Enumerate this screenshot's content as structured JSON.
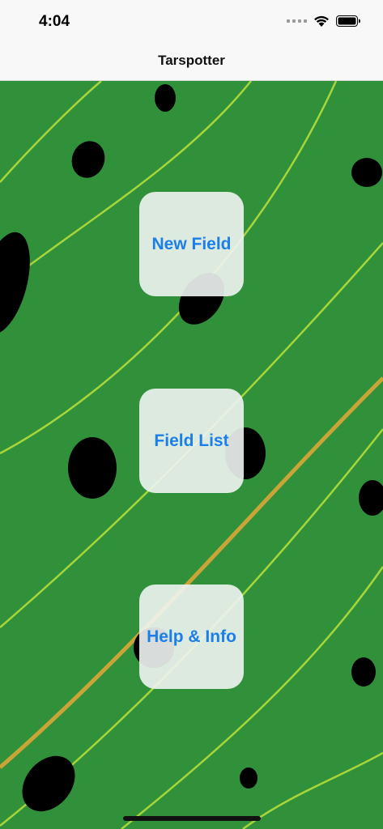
{
  "status_bar": {
    "time": "4:04",
    "icons": [
      "cellular-signal-icon",
      "wifi-icon",
      "battery-icon"
    ]
  },
  "nav": {
    "title": "Tarspotter"
  },
  "menu": {
    "new_field": "New Field",
    "field_list": "Field List",
    "help_info": "Help & Info"
  },
  "colors": {
    "field_green": "#31913a",
    "contour_line": "#a6d63a",
    "highlight_line": "#c9a437",
    "tar_spot": "#000000",
    "button_text": "#1a7fe8",
    "button_bg": "#f0f4f2"
  }
}
